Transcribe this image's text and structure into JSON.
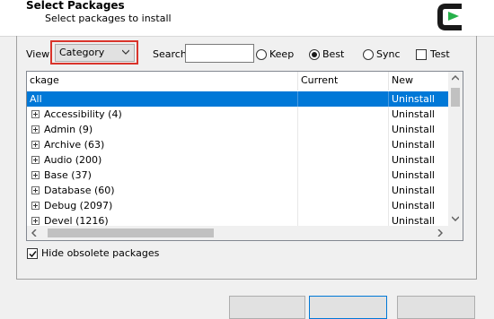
{
  "header": {
    "title": "Select Packages",
    "subtitle": "Select packages to install"
  },
  "toolbar": {
    "view_label": "View",
    "view_value": "Category",
    "search_label": "Search",
    "search_value": "",
    "radios": [
      {
        "label": "Keep",
        "checked": false
      },
      {
        "label": "Best",
        "checked": true
      },
      {
        "label": "Sync",
        "checked": false
      }
    ],
    "test_label": "Test",
    "test_checked": false
  },
  "table": {
    "columns": [
      "ckage",
      "Current",
      "New"
    ],
    "rows": [
      {
        "package": "All",
        "current": "",
        "new": "Uninstall",
        "selected": true,
        "expandable": false
      },
      {
        "package": "Accessibility (4)",
        "current": "",
        "new": "Uninstall",
        "selected": false,
        "expandable": true
      },
      {
        "package": "Admin (9)",
        "current": "",
        "new": "Uninstall",
        "selected": false,
        "expandable": true
      },
      {
        "package": "Archive (63)",
        "current": "",
        "new": "Uninstall",
        "selected": false,
        "expandable": true
      },
      {
        "package": "Audio (200)",
        "current": "",
        "new": "Uninstall",
        "selected": false,
        "expandable": true
      },
      {
        "package": "Base (37)",
        "current": "",
        "new": "Uninstall",
        "selected": false,
        "expandable": true
      },
      {
        "package": "Database (60)",
        "current": "",
        "new": "Uninstall",
        "selected": false,
        "expandable": true
      },
      {
        "package": "Debug (2097)",
        "current": "",
        "new": "Uninstall",
        "selected": false,
        "expandable": true
      },
      {
        "package": "Devel (1216)",
        "current": "",
        "new": "Uninstall",
        "selected": false,
        "expandable": true
      }
    ]
  },
  "options": {
    "hide_obsolete_label": "Hide obsolete packages",
    "hide_obsolete_checked": true
  },
  "colors": {
    "selection": "#0078d7",
    "highlight_outline": "#d9342b",
    "logo_green": "#26b14a"
  }
}
